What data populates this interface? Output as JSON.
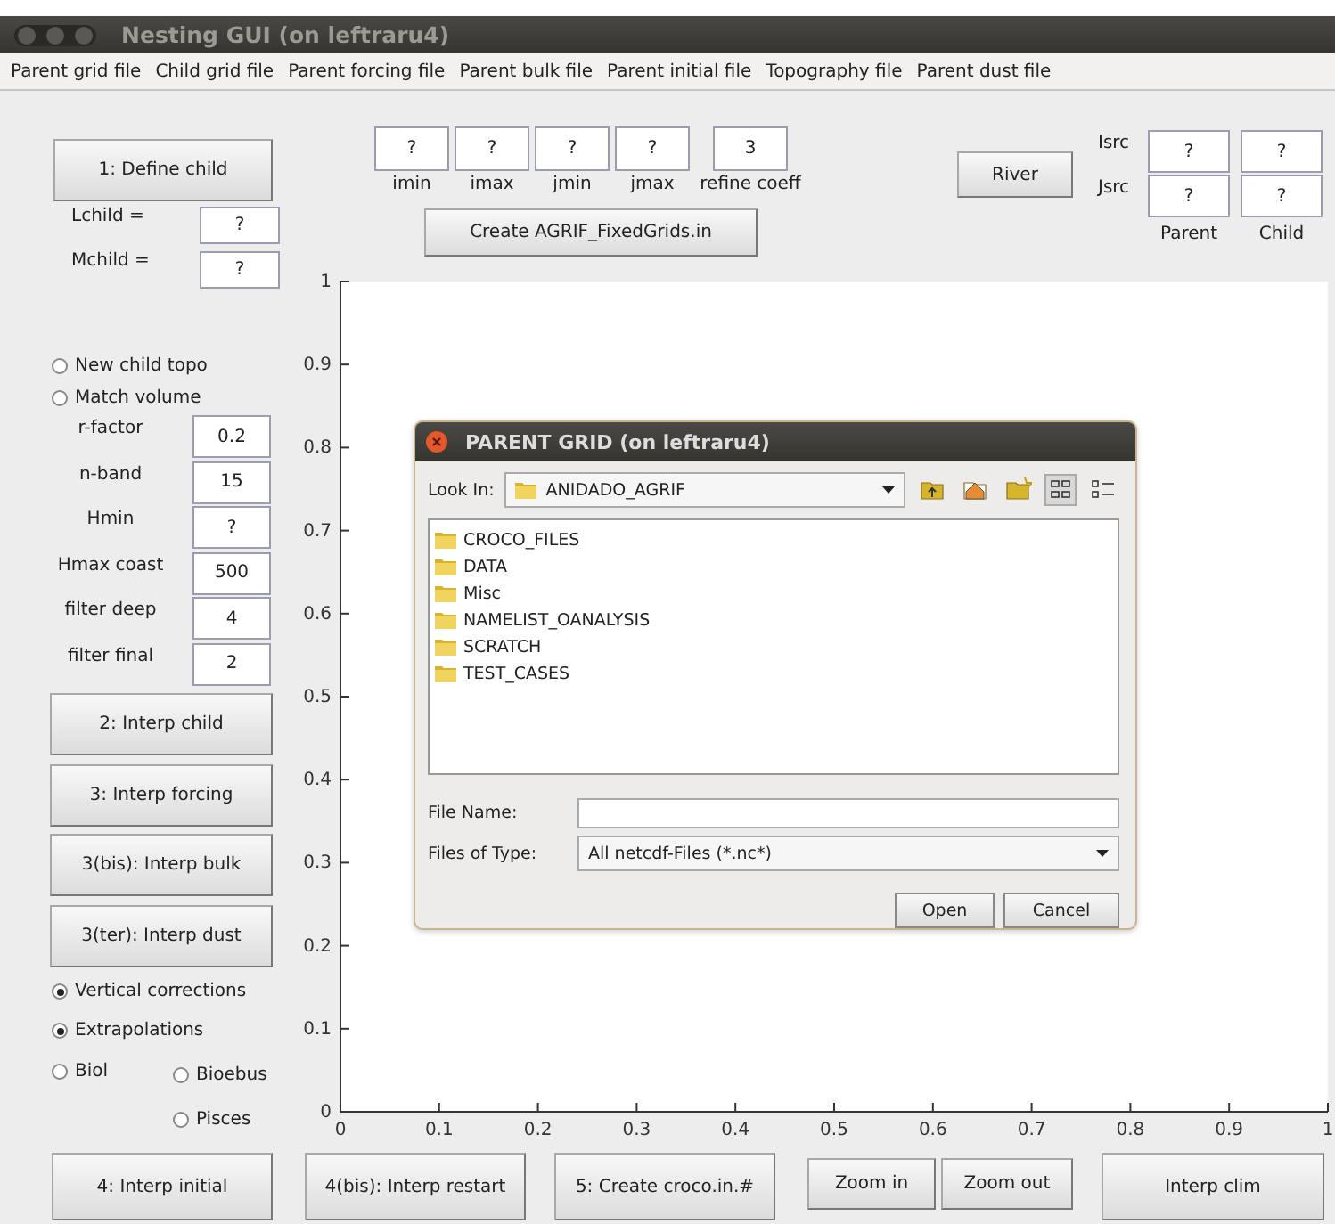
{
  "window": {
    "title": "Nesting GUI (on leftraru4)"
  },
  "menu": [
    "Parent grid file",
    "Child grid file",
    "Parent forcing file",
    "Parent bulk file",
    "Parent initial file",
    "Topography file",
    "Parent dust file"
  ],
  "define_button": "1: Define child",
  "child_size": [
    {
      "label": "Lchild =",
      "value": "?"
    },
    {
      "label": "Mchild =",
      "value": "?"
    }
  ],
  "grid_indices": [
    {
      "label": "imin",
      "value": "?"
    },
    {
      "label": "imax",
      "value": "?"
    },
    {
      "label": "jmin",
      "value": "?"
    },
    {
      "label": "jmax",
      "value": "?"
    },
    {
      "label": "refine coeff",
      "value": "3"
    }
  ],
  "create_button": "Create AGRIF_FixedGrids.in",
  "river": {
    "button": "River",
    "rows": [
      "Isrc",
      "Jsrc"
    ],
    "columns": [
      "Parent",
      "Child"
    ],
    "values": [
      [
        "?",
        "?"
      ],
      [
        "?",
        "?"
      ]
    ]
  },
  "topo_options": [
    {
      "label": "New child topo",
      "selected": false
    },
    {
      "label": "Match volume",
      "selected": false
    }
  ],
  "params": [
    {
      "label": "r-factor",
      "value": "0.2"
    },
    {
      "label": "n-band",
      "value": "15"
    },
    {
      "label": "Hmin",
      "value": "?"
    },
    {
      "label": "Hmax coast",
      "value": "500"
    },
    {
      "label": "filter deep",
      "value": "4"
    },
    {
      "label": "filter final",
      "value": "2"
    }
  ],
  "step_buttons": [
    "2: Interp child",
    "3: Interp forcing",
    "3(bis): Interp bulk",
    "3(ter): Interp dust"
  ],
  "options": [
    {
      "label": "Vertical corrections",
      "selected": true
    },
    {
      "label": "Extrapolations",
      "selected": true
    }
  ],
  "bio_options": [
    {
      "label": "Biol",
      "selected": false
    },
    {
      "label": "Bioebus",
      "selected": false
    },
    {
      "label": "Pisces",
      "selected": false
    }
  ],
  "axes": {
    "xticks": [
      "0",
      "0.1",
      "0.2",
      "0.3",
      "0.4",
      "0.5",
      "0.6",
      "0.7",
      "0.8",
      "0.9",
      "1"
    ],
    "yticks": [
      "1",
      "0.9",
      "0.8",
      "0.7",
      "0.6",
      "0.5",
      "0.4",
      "0.3",
      "0.2",
      "0.1",
      "0"
    ]
  },
  "bottom_buttons": [
    "4: Interp initial",
    "4(bis): Interp restart",
    "5: Create croco.in.#",
    "Zoom in",
    "Zoom out",
    "Interp clim"
  ],
  "dialog": {
    "title": "PARENT GRID (on leftraru4)",
    "look_in_label": "Look In:",
    "look_in": "ANIDADO_AGRIF",
    "folders": [
      "CROCO_FILES",
      "DATA",
      "Misc",
      "NAMELIST_OANALYSIS",
      "SCRATCH",
      "TEST_CASES"
    ],
    "file_name_label": "File Name:",
    "file_type_label": "Files of Type:",
    "file_type": "All netcdf-Files (*.nc*)",
    "buttons": [
      "Open",
      "Cancel"
    ]
  }
}
